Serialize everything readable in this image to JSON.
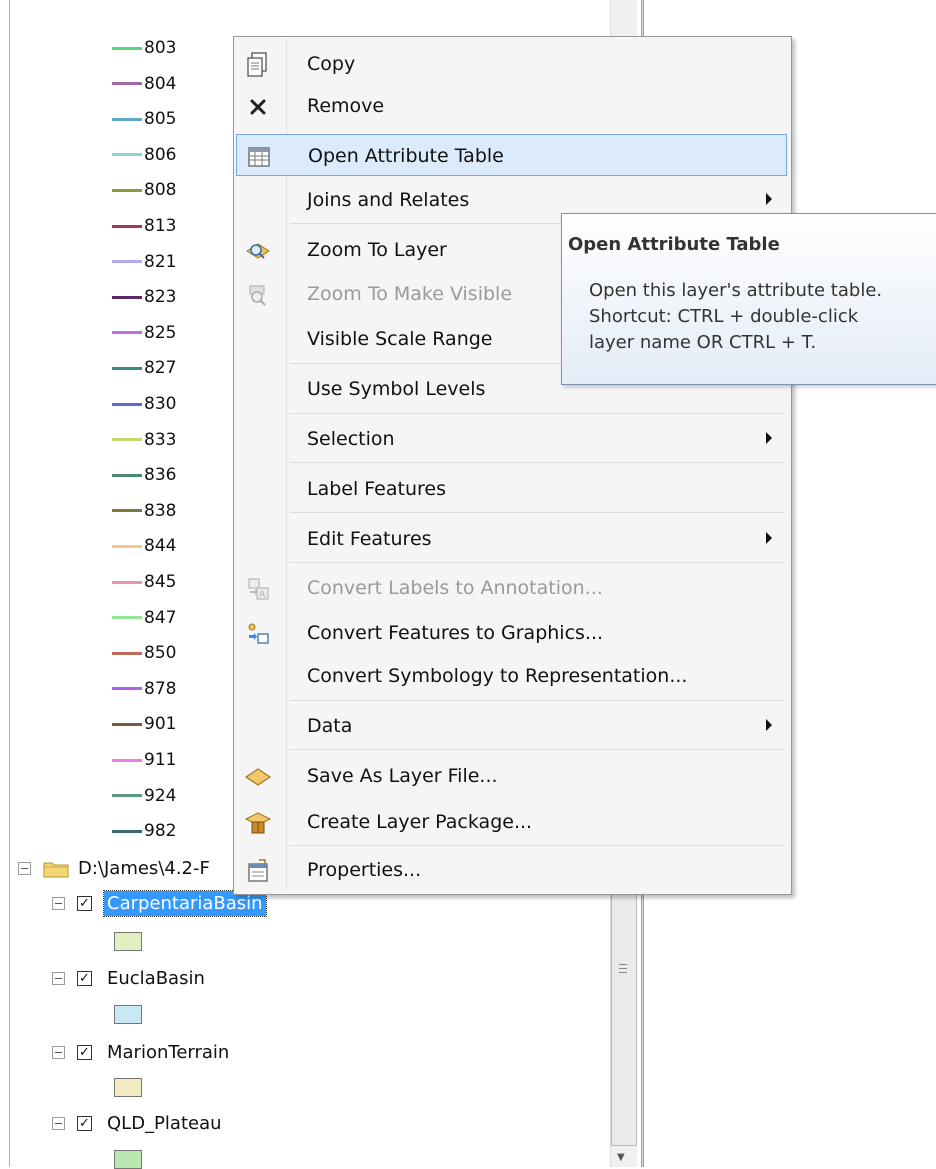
{
  "legend": {
    "items": [
      {
        "label": "803",
        "color": "#5bd37a"
      },
      {
        "label": "804",
        "color": "#a06aa6"
      },
      {
        "label": "805",
        "color": "#5fa8c8"
      },
      {
        "label": "806",
        "color": "#88d8d0"
      },
      {
        "label": "808",
        "color": "#8c9a3a"
      },
      {
        "label": "813",
        "color": "#a03a4a"
      },
      {
        "label": "821",
        "color": "#b8a8f0"
      },
      {
        "label": "823",
        "color": "#5a2a6a"
      },
      {
        "label": "825",
        "color": "#c070e0"
      },
      {
        "label": "827",
        "color": "#3a8a7a"
      },
      {
        "label": "830",
        "color": "#5a6ad0"
      },
      {
        "label": "833",
        "color": "#c8d870"
      },
      {
        "label": "836",
        "color": "#4a8a6a"
      },
      {
        "label": "838",
        "color": "#7a7a3a"
      },
      {
        "label": "844",
        "color": "#f5c88a"
      },
      {
        "label": "845",
        "color": "#f090b8"
      },
      {
        "label": "847",
        "color": "#90e890"
      },
      {
        "label": "850",
        "color": "#c06a5a"
      },
      {
        "label": "878",
        "color": "#b060e0"
      },
      {
        "label": "901",
        "color": "#7a5a40"
      },
      {
        "label": "911",
        "color": "#f080e0"
      },
      {
        "label": "924",
        "color": "#5a9a7a"
      },
      {
        "label": "982",
        "color": "#3a6a6a"
      }
    ]
  },
  "tree": {
    "folder_path": "D:\\James\\4.2-F",
    "layers": [
      {
        "name": "CarpentariaBasin",
        "swatch": "#e0f0c0",
        "selected": true
      },
      {
        "name": "EuclaBasin",
        "swatch": "#c8e8f4",
        "selected": false
      },
      {
        "name": "MarionTerrain",
        "swatch": "#f4ecc0",
        "selected": false
      },
      {
        "name": "QLD_Plateau",
        "swatch": "#b8e8b0",
        "selected": false
      }
    ]
  },
  "context_menu": {
    "items": [
      {
        "label": "Copy",
        "icon": "copy-icon"
      },
      {
        "label": "Remove",
        "icon": "remove-icon"
      },
      {
        "label": "Open Attribute Table",
        "icon": "table-icon",
        "highlighted": true
      },
      {
        "label": "Joins and Relates",
        "submenu": true
      },
      {
        "label": "Zoom To Layer",
        "icon": "zoom-to-layer-icon"
      },
      {
        "label": "Zoom To Make Visible",
        "icon": "zoom-visible-icon",
        "disabled": true
      },
      {
        "label": "Visible Scale Range"
      },
      {
        "label": "Use Symbol Levels"
      },
      {
        "label": "Selection",
        "submenu": true
      },
      {
        "label": "Label Features"
      },
      {
        "label": "Edit Features",
        "submenu": true
      },
      {
        "label": "Convert Labels to Annotation...",
        "icon": "convert-labels-icon",
        "disabled": true
      },
      {
        "label": "Convert Features to Graphics...",
        "icon": "convert-graphics-icon"
      },
      {
        "label": "Convert Symbology to Representation..."
      },
      {
        "label": "Data",
        "submenu": true
      },
      {
        "label": "Save As Layer File...",
        "icon": "layer-file-icon"
      },
      {
        "label": "Create Layer Package...",
        "icon": "layer-package-icon"
      },
      {
        "label": "Properties...",
        "icon": "properties-icon"
      }
    ]
  },
  "tooltip": {
    "title": "Open Attribute Table",
    "line1": "Open this layer's attribute table.",
    "line2": "Shortcut: CTRL + double-click",
    "line3": "layer name OR CTRL + T."
  }
}
